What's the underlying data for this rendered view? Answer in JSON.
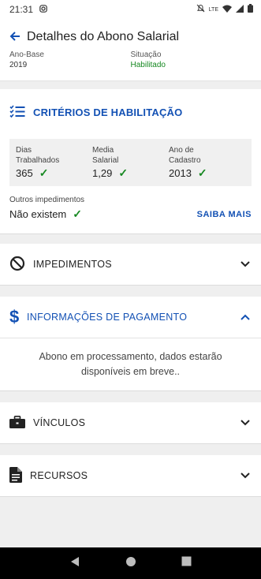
{
  "status": {
    "time": "21:31",
    "network_label": "LTE",
    "instagram_icon": "instagram-icon",
    "mute_icon": "mute-icon",
    "wifi_icon": "wifi-icon",
    "signal_icon": "signal-icon",
    "battery_icon": "battery-icon"
  },
  "header": {
    "title": "Detalhes do Abono Salarial",
    "ano_base_label": "Ano-Base",
    "ano_base_value": "2019",
    "situacao_label": "Situação",
    "situacao_value": "Habilitado"
  },
  "criteria": {
    "title": "CRITÉRIOS DE HABILITAÇÃO",
    "stats": [
      {
        "label_line1": "Dias",
        "label_line2": "Trabalhados",
        "value": "365"
      },
      {
        "label_line1": "Media",
        "label_line2": "Salarial",
        "value": "1,29"
      },
      {
        "label_line1": "Ano de",
        "label_line2": "Cadastro",
        "value": "2013"
      }
    ],
    "others_label": "Outros impedimentos",
    "others_value": "Não existem",
    "more_link": "SAIBA MAIS"
  },
  "sections": {
    "impedimentos": "IMPEDIMENTOS",
    "pagamento": "INFORMAÇÕES DE PAGAMENTO",
    "pagamento_body": "Abono em processamento, dados estarão disponíveis em breve..",
    "vinculos": "VÍNCULOS",
    "recursos": "RECURSOS"
  },
  "colors": {
    "primary_blue": "#1351b4",
    "success_green": "#168821"
  }
}
